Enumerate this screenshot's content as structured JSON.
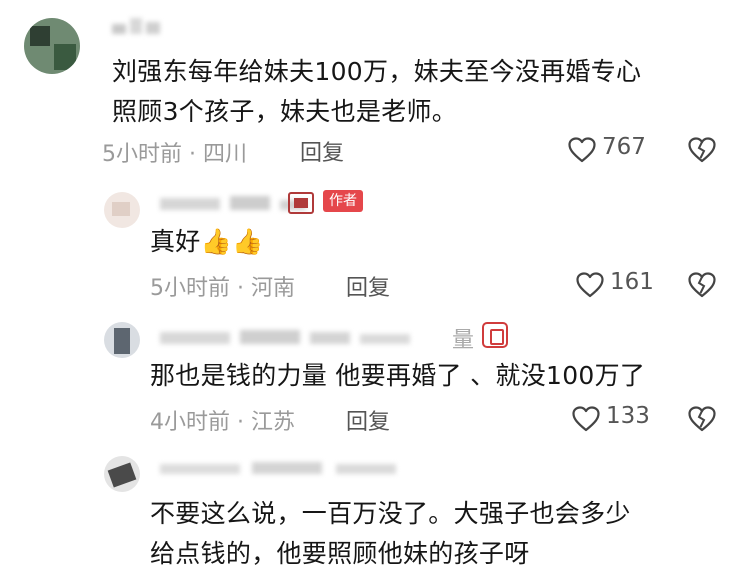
{
  "comments": [
    {
      "text_line1": "刘强东每年给妹夫100万，妹夫至今没再婚专心",
      "text_line2": "照顾3个孩子，妹夫也是老师。",
      "time_location": "5小时前 · 四川",
      "reply_label": "回复",
      "likes": "767"
    },
    {
      "author_badge": "作者",
      "text": "真好",
      "emoji": "👍👍",
      "time_location": "5小时前 · 河南",
      "reply_label": "回复",
      "likes": "161"
    },
    {
      "name_fragment": "量",
      "text": "那也是钱的力量 他要再婚了 、就没100万了",
      "time_location": "4小时前 · 江苏",
      "reply_label": "回复",
      "likes": "133"
    },
    {
      "text_line1": "不要这么说，一百万没了。大强子也会多少",
      "text_line2": "给点钱的，他要照顾他妹的孩子呀"
    }
  ],
  "icons": {
    "like": "heart-outline-icon",
    "dislike": "broken-heart-icon",
    "fan_badge": "fan-badge-icon"
  },
  "colors": {
    "badge": "#e5474b",
    "meta": "#9a9a9a"
  }
}
